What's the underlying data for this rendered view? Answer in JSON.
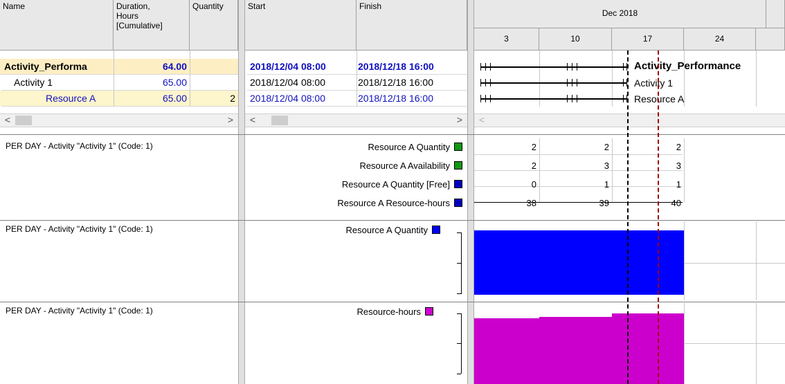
{
  "grid": {
    "columns": {
      "name": "Name",
      "duration": "Duration,\nHours\n[Cumulative]",
      "quantity": "Quantity",
      "start": "Start",
      "finish": "Finish"
    },
    "rows": [
      {
        "name": "Activity_Performa",
        "duration": "64.00",
        "quantity": "",
        "start": "2018/12/04  08:00",
        "finish": "2018/12/18  16:00"
      },
      {
        "name": "Activity 1",
        "duration": "65.00",
        "quantity": "",
        "start": "2018/12/04  08:00",
        "finish": "2018/12/18  16:00"
      },
      {
        "name": "Resource A",
        "duration": "65.00",
        "quantity": "2",
        "start": "2018/12/04  08:00",
        "finish": "2018/12/18  16:00"
      }
    ]
  },
  "gantt": {
    "month": "Dec 2018",
    "weeks": [
      "3",
      "10",
      "17",
      "24"
    ],
    "bar_labels": [
      "Activity_Performance",
      "Activity 1",
      "Resource A"
    ]
  },
  "scrollbars": {
    "left_arrow": "<",
    "right_arrow": ">"
  },
  "panels": [
    {
      "title": "PER DAY - Activity \"Activity 1\" (Code: 1)",
      "legend": [
        {
          "label": "Resource A Quantity",
          "color": "#119911"
        },
        {
          "label": "Resource A Availability",
          "color": "#119911"
        },
        {
          "label": "Resource A Quantity [Free]",
          "color": "#0000c0"
        },
        {
          "label": "Resource A Resource-hours",
          "color": "#0000c0"
        }
      ],
      "table": [
        [
          "2",
          "2",
          "2"
        ],
        [
          "2",
          "3",
          "3"
        ],
        [
          "0",
          "1",
          "1"
        ],
        [
          "38",
          "39",
          "40"
        ]
      ]
    },
    {
      "title": "PER DAY - Activity \"Activity 1\" (Code: 1)",
      "legend": [
        {
          "label": "Resource A Quantity",
          "color": "#0000ff"
        }
      ],
      "histogram_color": "#0000ff"
    },
    {
      "title": "PER DAY - Activity \"Activity 1\" (Code: 1)",
      "legend": [
        {
          "label": "Resource-hours",
          "color": "#cc00cc"
        }
      ],
      "histogram_color": "#cc00cc"
    }
  ]
}
